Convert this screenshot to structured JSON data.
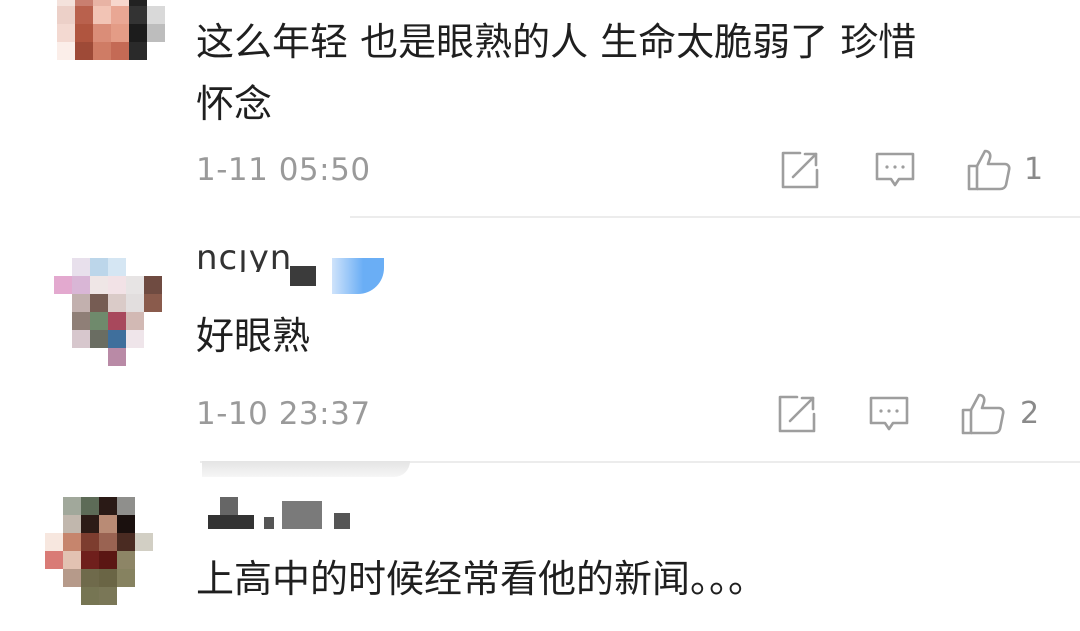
{
  "comments": [
    {
      "text_line1": "这么年轻 也是眼熟的人 生命太脆弱了 珍惜",
      "text_line2": "怀念",
      "time": "1-11 05:50",
      "likes": "1",
      "icons": [
        "share-icon",
        "comment-icon",
        "thumbs-up-icon"
      ]
    },
    {
      "username": "ncjyn",
      "text": "好眼熟",
      "time": "1-10 23:37",
      "likes": "2",
      "icons": [
        "share-icon",
        "comment-icon",
        "thumbs-up-icon"
      ]
    },
    {
      "text": "上高中的时候经常看他的新闻。。。"
    }
  ],
  "colors": {
    "text": "#1f1f1f",
    "meta": "#9a9a9a",
    "icon": "#9e9e9e",
    "divider": "#ececec",
    "badge": "#6aaef5"
  }
}
